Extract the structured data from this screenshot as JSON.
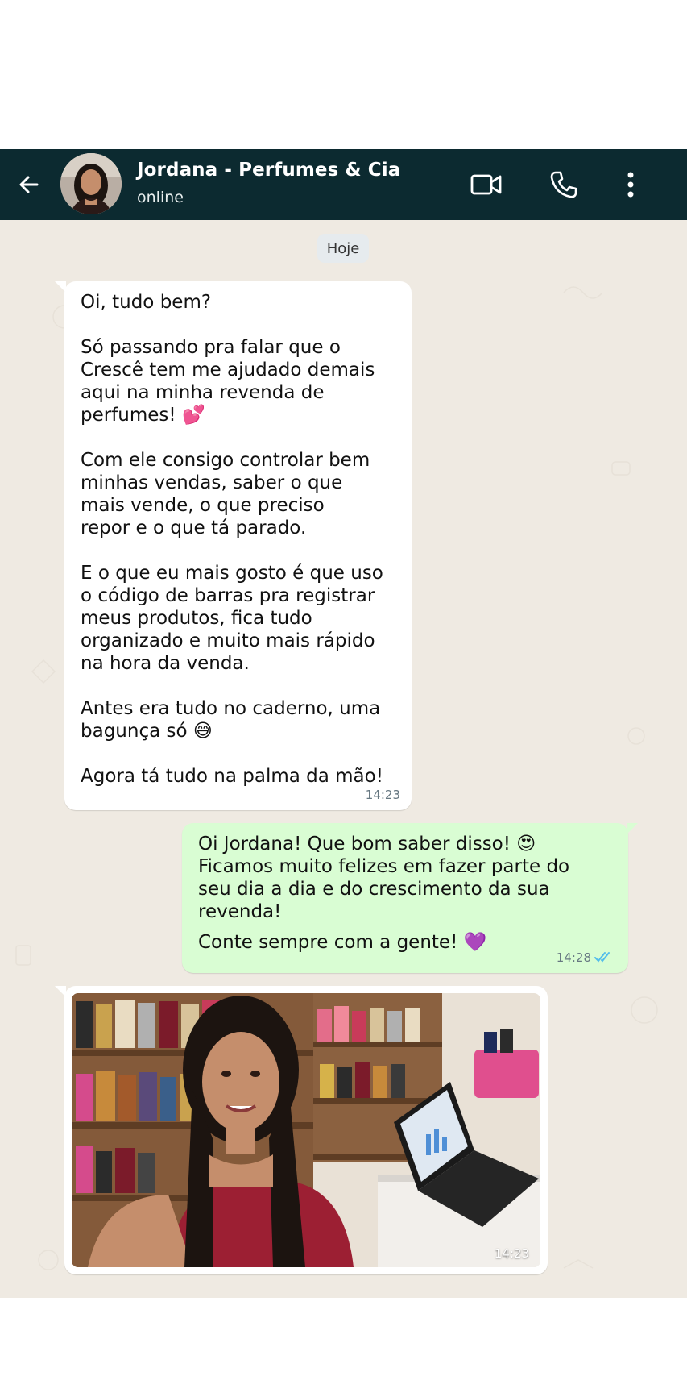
{
  "header": {
    "contact_name": "Jordana - Perfumes & Cia",
    "status": "online",
    "back_icon": "arrow-left-icon",
    "video_icon": "video-camera-icon",
    "call_icon": "phone-icon",
    "menu_icon": "more-vertical-icon",
    "bg_color": "#0c2a30"
  },
  "chat": {
    "date_label": "Hoje",
    "bg_color": "#efeae2",
    "messages": [
      {
        "direction": "incoming",
        "paragraphs": [
          "Oi, tudo bem?",
          "Só passando pra falar que o\nCrescê tem me ajudado demais\naqui na minha revenda de\nperfumes! 💕",
          "Com ele consigo controlar bem\nminhas vendas, saber o que\nmais vende, o que preciso\nrepor e o que tá parado.",
          "E o que eu mais gosto é que uso\no código de barras pra registrar\nmeus produtos, fica tudo\norganizado e muito mais rápido\nna hora da venda.",
          "Antes era tudo no caderno, uma\nbagunça só 😅",
          "Agora tá tudo na palma da mão!"
        ],
        "time": "14:23"
      },
      {
        "direction": "outgoing",
        "paragraphs": [
          "Oi Jordana! Que bom saber disso! 😍\nFicamos muito felizes em fazer parte do\nseu dia a dia e do crescimento da sua\nrevenda!",
          "Conte sempre com a gente! 💜"
        ],
        "time": "14:28",
        "status_icon": "double-check-read-icon",
        "tick_color": "#53bdeb"
      },
      {
        "direction": "incoming",
        "type": "image",
        "image_icon": "photo-selfie-perfume-shop",
        "time": "14:23"
      }
    ]
  },
  "colors": {
    "incoming_bubble": "#ffffff",
    "outgoing_bubble": "#d9fdd3",
    "timestamp": "#667781"
  }
}
